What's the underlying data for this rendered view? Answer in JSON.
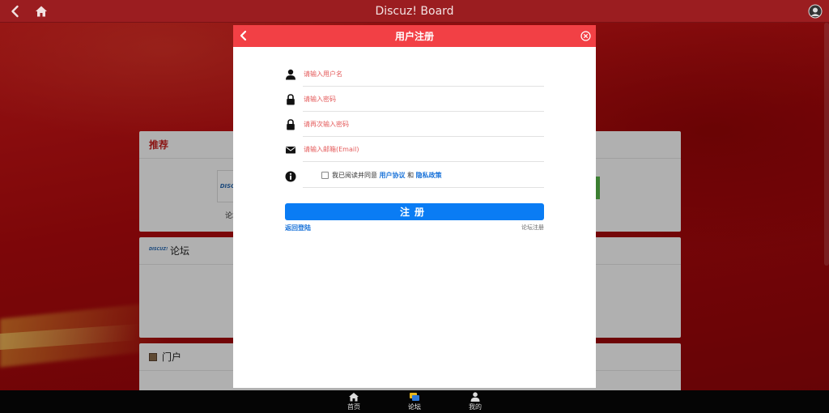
{
  "topbar": {
    "title": "Discuz! Board",
    "back_icon": "chevron-left-icon",
    "home_icon": "home-icon",
    "user_icon": "user-avatar-icon"
  },
  "background": {
    "recommend_title": "推荐",
    "recommend_item_logo": "DISCUZ!",
    "recommend_item_caption": "论坛",
    "forum_title": "论坛",
    "forum_logo": "DISCUZ!",
    "portal_title": "门户"
  },
  "modal": {
    "title": "用户注册",
    "fields": [
      {
        "icon": "user-icon",
        "placeholder": "请输入用户名",
        "value": ""
      },
      {
        "icon": "lock-icon",
        "placeholder": "请输入密码",
        "value": ""
      },
      {
        "icon": "lock-icon",
        "placeholder": "请再次输入密码",
        "value": ""
      },
      {
        "icon": "envelope-icon",
        "placeholder": "请输入邮箱(Email)",
        "value": ""
      }
    ],
    "agree": {
      "prefix": "我已阅读并同意",
      "user_agreement": "用户协议",
      "and": "和",
      "privacy_policy": "隐私政策",
      "checked": false
    },
    "submit_label": "注册",
    "back_to_login": "返回登陆",
    "forum_register": "论坛注册",
    "accent_color": "#f24045",
    "button_color": "#0a7cf4"
  },
  "tabbar": {
    "items": [
      {
        "label": "首页",
        "icon": "home-icon"
      },
      {
        "label": "论坛",
        "icon": "forum-icon",
        "active": true
      },
      {
        "label": "我的",
        "icon": "person-icon"
      }
    ]
  }
}
